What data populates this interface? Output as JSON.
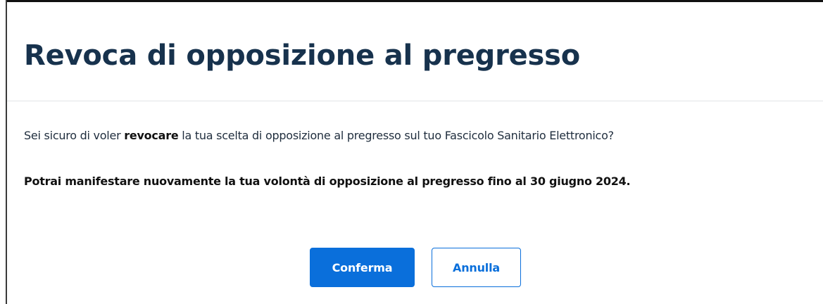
{
  "modal": {
    "title": "Revoca di opposizione al pregresso",
    "question_prefix": "Sei sicuro di voler ",
    "question_bold": "revocare",
    "question_suffix": " la tua scelta di opposizione al pregresso sul tuo Fascicolo Sanitario Elettronico?",
    "notice": "Potrai manifestare nuovamente la tua volontà di opposizione al pregresso fino al 30 giugno 2024.",
    "confirm_label": "Conferma",
    "cancel_label": "Annulla"
  },
  "colors": {
    "primary": "#0a6fdb",
    "title_text": "#17324d",
    "body_text": "#1f2d3d",
    "divider": "#e3e4e6"
  }
}
